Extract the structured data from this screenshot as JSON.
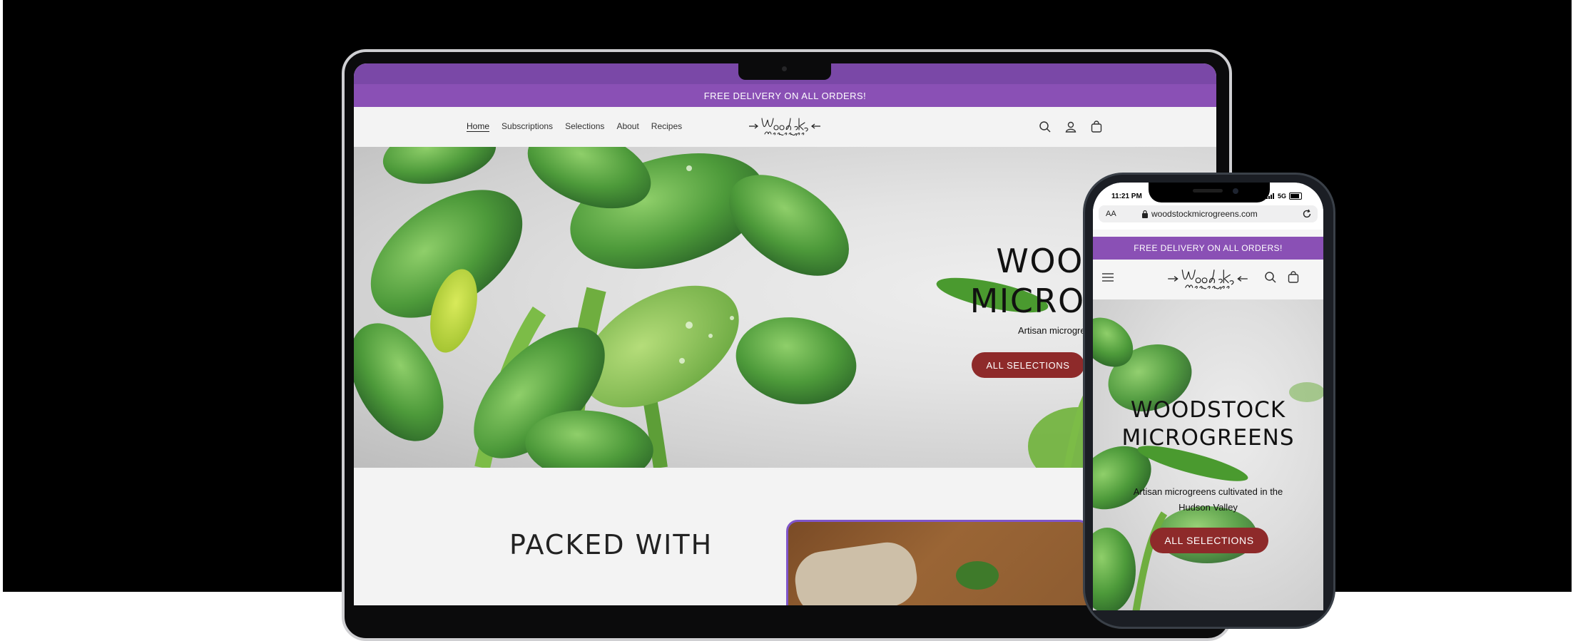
{
  "laptop": {
    "announcement": "FREE DELIVERY ON ALL ORDERS!",
    "nav": [
      {
        "label": "Home",
        "active": true
      },
      {
        "label": "Subscriptions",
        "active": false
      },
      {
        "label": "Selections",
        "active": false
      },
      {
        "label": "About",
        "active": false
      },
      {
        "label": "Recipes",
        "active": false
      }
    ],
    "header_icons": [
      "search-icon",
      "account-icon",
      "cart-icon"
    ],
    "hero": {
      "title_line1": "WOODSTOCK",
      "title_line2": "MICROGREENS",
      "subtitle": "Artisan microgreens cultivated in the Hudson Valley",
      "button": "ALL SELECTIONS"
    },
    "section_heading": "PACKED WITH"
  },
  "phone": {
    "time": "11:21 PM",
    "network": "5G",
    "aa": "AA",
    "url": "woodstockmicrogreens.com",
    "announcement": "FREE DELIVERY ON ALL ORDERS!",
    "header_icons": [
      "menu-icon",
      "search-icon",
      "cart-icon"
    ],
    "hero": {
      "title_line1": "WOODSTOCK",
      "title_line2": "MICROGREENS",
      "subtitle": "Artisan microgreens cultivated in the Hudson Valley",
      "button": "ALL SELECTIONS"
    }
  },
  "colors": {
    "brand_purple": "#8a50b5",
    "button_red": "#8e2a2a",
    "leaf_green": "#5aa83a"
  },
  "logo_text": [
    "Woodstock",
    "Microgreens"
  ]
}
